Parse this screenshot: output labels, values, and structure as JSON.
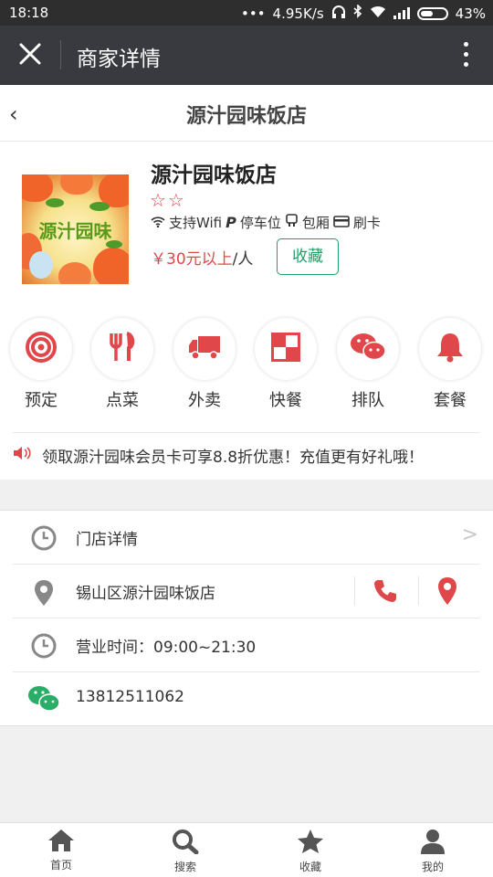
{
  "status_bar": {
    "time": "18:18",
    "dots": "•••",
    "network_speed": "4.95K/s",
    "battery_percent": "43%"
  },
  "titlebar": {
    "title": "商家详情"
  },
  "header": {
    "back_label": "‹",
    "shop_name": "源汁园味饭店"
  },
  "shop": {
    "logo_text": "源汁园味",
    "name": "源汁园味饭店",
    "stars": "☆☆",
    "amenities": [
      "支持Wifi",
      "停车位",
      "包厢",
      "刷卡"
    ],
    "price_amount": "￥30元以上",
    "price_unit": "/人",
    "favorite_label": "收藏"
  },
  "categories": [
    {
      "label": "预定",
      "icon": "target-icon"
    },
    {
      "label": "点菜",
      "icon": "fork-knife-icon"
    },
    {
      "label": "外卖",
      "icon": "truck-icon"
    },
    {
      "label": "快餐",
      "icon": "checker-icon"
    },
    {
      "label": "排队",
      "icon": "chat-bubbles-icon"
    },
    {
      "label": "套餐",
      "icon": "bell-icon"
    }
  ],
  "notice": {
    "text": "领取源汁园味会员卡可享8.8折优惠！充值更有好礼哦！"
  },
  "details": {
    "store_details": "门店详情",
    "arrow": ">",
    "address": "锡山区源汁园味饭店",
    "hours": "营业时间：09:00~21:30",
    "wechat": "13812511062"
  },
  "tabs": [
    {
      "label": "首页",
      "icon": "home-icon"
    },
    {
      "label": "搜索",
      "icon": "search-icon"
    },
    {
      "label": "收藏",
      "icon": "star-icon"
    },
    {
      "label": "我的",
      "icon": "user-icon"
    }
  ],
  "colors": {
    "accent_red": "#e0474b",
    "green": "#1fa066",
    "titlebar_bg": "#393a3f"
  }
}
